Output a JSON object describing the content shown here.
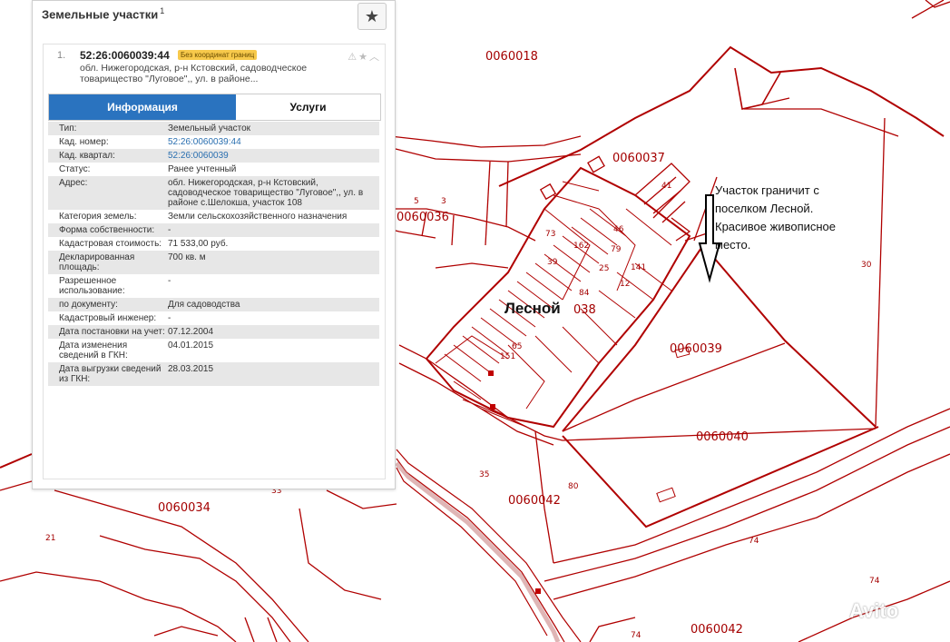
{
  "panel": {
    "title": "Земельные участки",
    "title_sup": "1",
    "fav_icon": "★",
    "card": {
      "index": "1.",
      "cad_number": "52:26:0060039:44",
      "badge": "Без координат границ",
      "icons": "⚠★︿",
      "address_short": "обл. Нижегородская, р-н Кстовский, садоводческое товарищество \"Луговое\",, ул. в районе..."
    },
    "tabs": {
      "info": "Информация",
      "services": "Услуги"
    },
    "rows": [
      {
        "k": "Тип:",
        "v": "Земельный участок"
      },
      {
        "k": "Кад. номер:",
        "v": "52:26:0060039:44",
        "link": true
      },
      {
        "k": "Кад. квартал:",
        "v": "52:26:0060039",
        "link": true
      },
      {
        "k": "Статус:",
        "v": "Ранее учтенный"
      },
      {
        "k": "Адрес:",
        "v": "обл. Нижегородская, р-н Кстовский, садоводческое товарищество \"Луговое\",, ул. в районе с.Шелокша, участок 108"
      },
      {
        "k": "Категория земель:",
        "v": "Земли сельскохозяйственного назначения"
      },
      {
        "k": "Форма собственности:",
        "v": "-"
      },
      {
        "k": "Кадастровая стоимость:",
        "v": "71 533,00 руб."
      },
      {
        "k": "Декларированная площадь:",
        "v": "700 кв. м"
      },
      {
        "k": "Разрешенное использование:",
        "v": "-"
      },
      {
        "k": "по документу:",
        "v": "Для садоводства"
      },
      {
        "k": "Кадастровый инженер:",
        "v": "-"
      },
      {
        "k": "Дата постановки на учет:",
        "v": "07.12.2004"
      },
      {
        "k": "Дата изменения сведений в ГКН:",
        "v": "04.01.2015"
      },
      {
        "k": "Дата выгрузки сведений из ГКН:",
        "v": "28.03.2015"
      }
    ]
  },
  "map": {
    "labels": {
      "q0018": "0060018",
      "q0037": "0060037",
      "q0036": "0060036",
      "q0038": "038",
      "q0039": "0060039",
      "q0040": "0060040",
      "q0042a": "0060042",
      "q0042b": "0060042",
      "q0034": "0060034",
      "n35": "35",
      "n80": "80",
      "n74a": "74",
      "n74b": "74",
      "n74c": "74",
      "n30": "30",
      "n33": "33",
      "n21": "21",
      "n5": "5",
      "n3": "3",
      "p73": "73",
      "p162": "162",
      "p39": "39",
      "p46": "46",
      "p79": "79",
      "p25": "25",
      "p141": "141",
      "p12": "12",
      "p84": "84",
      "p65": "65",
      "p151": "151",
      "p41": "41"
    },
    "place_name": "Лесной",
    "note": [
      "Участок граничит с",
      "поселком Лесной.",
      "Красивое живописное",
      "место."
    ],
    "watermark": "Avito",
    "line_color": "#b00000"
  }
}
